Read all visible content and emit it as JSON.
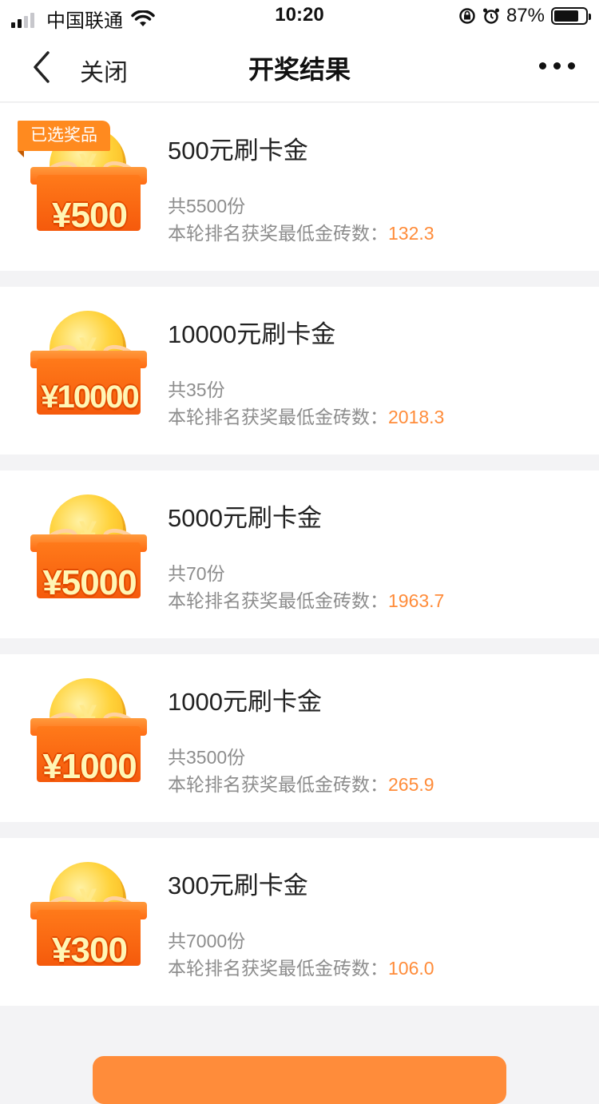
{
  "status_bar": {
    "carrier": "中国联通",
    "time": "10:20",
    "battery_percent": "87%"
  },
  "nav": {
    "close_label": "关闭",
    "title": "开奖结果"
  },
  "prizes": [
    {
      "amount_label": "¥500",
      "name": "500元刷卡金",
      "count": "共5500份",
      "min_label": "本轮排名获奖最低金砖数：",
      "min_value": "132.3",
      "selected_tag": "已选奖品"
    },
    {
      "amount_label": "¥10000",
      "name": "10000元刷卡金",
      "count": "共35份",
      "min_label": "本轮排名获奖最低金砖数：",
      "min_value": "2018.3"
    },
    {
      "amount_label": "¥5000",
      "name": "5000元刷卡金",
      "count": "共70份",
      "min_label": "本轮排名获奖最低金砖数：",
      "min_value": "1963.7"
    },
    {
      "amount_label": "¥1000",
      "name": "1000元刷卡金",
      "count": "共3500份",
      "min_label": "本轮排名获奖最低金砖数：",
      "min_value": "265.9"
    },
    {
      "amount_label": "¥300",
      "name": "300元刷卡金",
      "count": "共7000份",
      "min_label": "本轮排名获奖最低金砖数：",
      "min_value": "106.0"
    }
  ],
  "colors": {
    "accent": "#ff8c3a",
    "background": "#f3f3f5"
  }
}
